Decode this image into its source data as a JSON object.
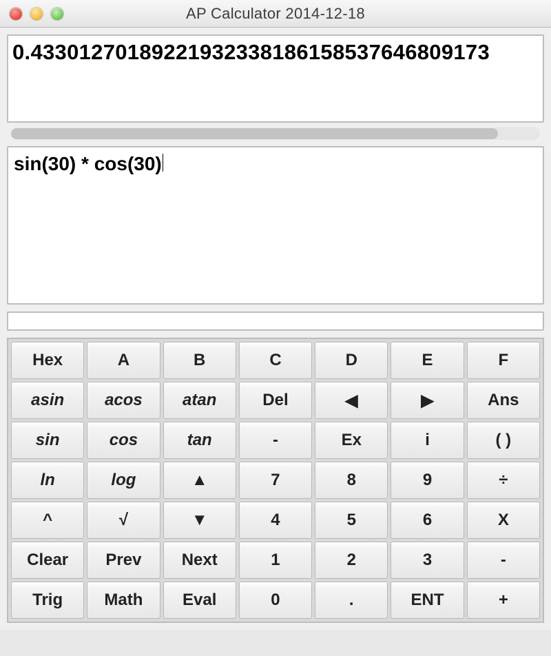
{
  "title": "AP Calculator 2014-12-18",
  "result": "0.43301270189221932338186158537646809173",
  "expression": "sin(30) * cos(30)",
  "status": "",
  "keypad": {
    "rows": [
      [
        {
          "id": "hex",
          "label": "Hex",
          "italic": false
        },
        {
          "id": "hex-a",
          "label": "A",
          "italic": false
        },
        {
          "id": "hex-b",
          "label": "B",
          "italic": false
        },
        {
          "id": "hex-c",
          "label": "C",
          "italic": false
        },
        {
          "id": "hex-d",
          "label": "D",
          "italic": false
        },
        {
          "id": "hex-e",
          "label": "E",
          "italic": false
        },
        {
          "id": "hex-f",
          "label": "F",
          "italic": false
        }
      ],
      [
        {
          "id": "asin",
          "label": "asin",
          "italic": true
        },
        {
          "id": "acos",
          "label": "acos",
          "italic": true
        },
        {
          "id": "atan",
          "label": "atan",
          "italic": true
        },
        {
          "id": "del",
          "label": "Del",
          "italic": false
        },
        {
          "id": "left",
          "label": "◀",
          "italic": false
        },
        {
          "id": "right",
          "label": "▶",
          "italic": false
        },
        {
          "id": "ans",
          "label": "Ans",
          "italic": false
        }
      ],
      [
        {
          "id": "sin",
          "label": "sin",
          "italic": true
        },
        {
          "id": "cos",
          "label": "cos",
          "italic": true
        },
        {
          "id": "tan",
          "label": "tan",
          "italic": true
        },
        {
          "id": "minus-sign",
          "label": "-",
          "italic": false
        },
        {
          "id": "ex",
          "label": "Ex",
          "italic": false
        },
        {
          "id": "imag",
          "label": "i",
          "italic": false
        },
        {
          "id": "parens",
          "label": "( )",
          "italic": false
        }
      ],
      [
        {
          "id": "ln",
          "label": "ln",
          "italic": true
        },
        {
          "id": "log",
          "label": "log",
          "italic": true
        },
        {
          "id": "up",
          "label": "▲",
          "italic": false
        },
        {
          "id": "d7",
          "label": "7",
          "italic": false
        },
        {
          "id": "d8",
          "label": "8",
          "italic": false
        },
        {
          "id": "d9",
          "label": "9",
          "italic": false
        },
        {
          "id": "divide",
          "label": "÷",
          "italic": false
        }
      ],
      [
        {
          "id": "power",
          "label": "^",
          "italic": false
        },
        {
          "id": "sqrt",
          "label": "√",
          "italic": false
        },
        {
          "id": "down",
          "label": "▼",
          "italic": false
        },
        {
          "id": "d4",
          "label": "4",
          "italic": false
        },
        {
          "id": "d5",
          "label": "5",
          "italic": false
        },
        {
          "id": "d6",
          "label": "6",
          "italic": false
        },
        {
          "id": "multiply",
          "label": "X",
          "italic": false
        }
      ],
      [
        {
          "id": "clear",
          "label": "Clear",
          "italic": false
        },
        {
          "id": "prev",
          "label": "Prev",
          "italic": false
        },
        {
          "id": "next",
          "label": "Next",
          "italic": false
        },
        {
          "id": "d1",
          "label": "1",
          "italic": false
        },
        {
          "id": "d2",
          "label": "2",
          "italic": false
        },
        {
          "id": "d3",
          "label": "3",
          "italic": false
        },
        {
          "id": "subtract",
          "label": "-",
          "italic": false
        }
      ],
      [
        {
          "id": "trig",
          "label": "Trig",
          "italic": false
        },
        {
          "id": "math",
          "label": "Math",
          "italic": false
        },
        {
          "id": "eval",
          "label": "Eval",
          "italic": false
        },
        {
          "id": "d0",
          "label": "0",
          "italic": false
        },
        {
          "id": "dot",
          "label": ".",
          "italic": false
        },
        {
          "id": "ent",
          "label": "ENT",
          "italic": false
        },
        {
          "id": "add",
          "label": "+",
          "italic": false
        }
      ]
    ]
  }
}
